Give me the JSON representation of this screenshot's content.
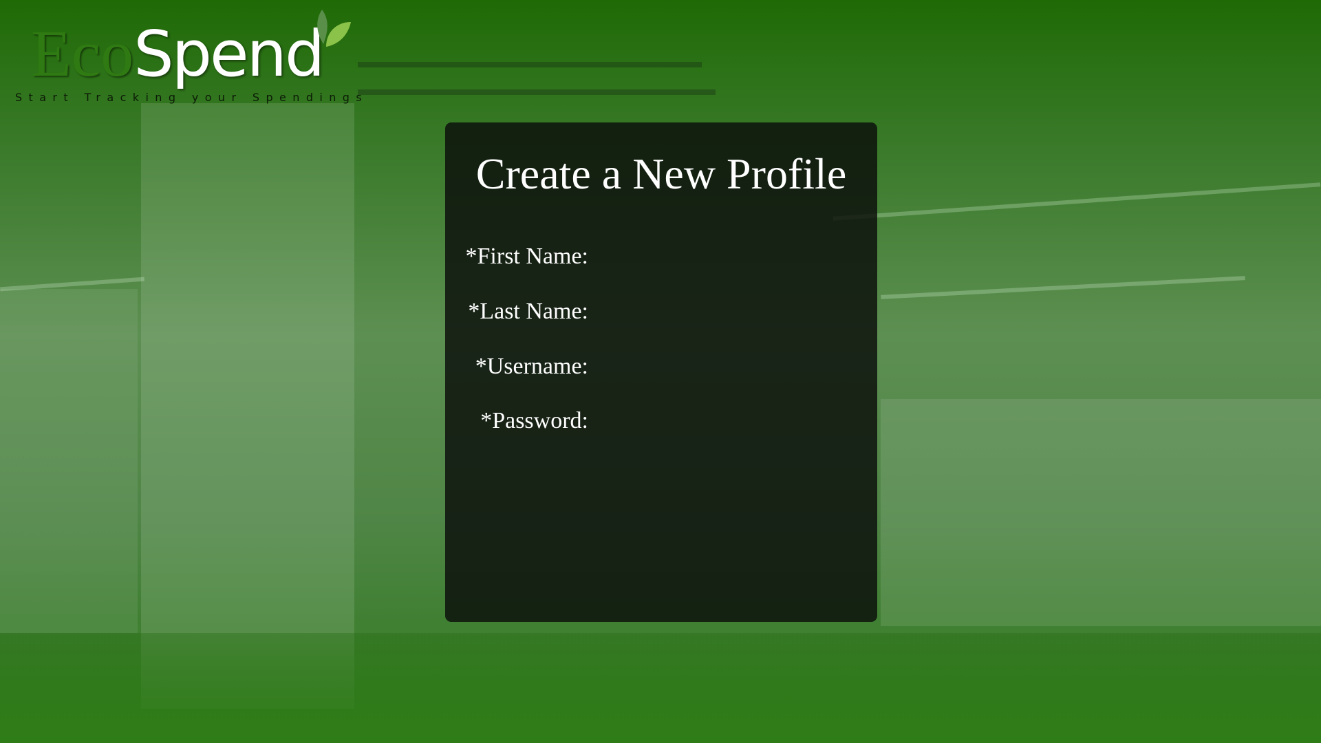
{
  "brand": {
    "eco": "Eco",
    "spend": "Spend",
    "tagline": "Start Tracking your Spendings",
    "colors": {
      "eco": "#2f7a12",
      "accent": "#8bc34a"
    }
  },
  "form": {
    "title": "Create a New Profile",
    "fields": [
      {
        "label": "*First Name:"
      },
      {
        "label": "*Last Name:"
      },
      {
        "label": "*Username:"
      },
      {
        "label": "*Password:"
      }
    ]
  }
}
